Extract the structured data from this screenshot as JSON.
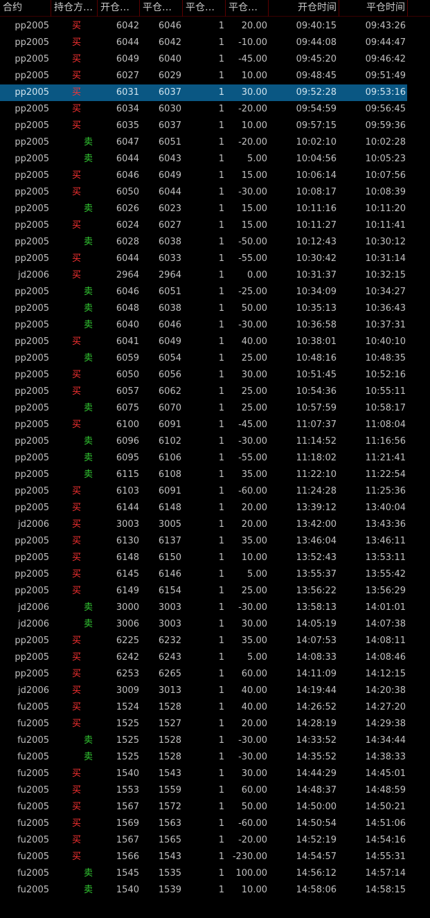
{
  "colors": {
    "background": "#000000",
    "text": "#c0c0c0",
    "buy": "#ff3333",
    "sell": "#33cc33",
    "selected_row": "#0a5783",
    "header_border": "#5a0000"
  },
  "headers": [
    "合约",
    "持仓方…",
    "开仓…",
    "平仓…",
    "平仓…",
    "平仓…",
    "开仓时间",
    "平仓时间"
  ],
  "selected_index": 4,
  "rows": [
    {
      "contract": "pp2005",
      "dir": "买",
      "open": "6042",
      "close": "6046",
      "qty": "1",
      "pnl": "20.00",
      "open_time": "09:40:15",
      "close_time": "09:43:26"
    },
    {
      "contract": "pp2005",
      "dir": "买",
      "open": "6044",
      "close": "6042",
      "qty": "1",
      "pnl": "-10.00",
      "open_time": "09:44:08",
      "close_time": "09:44:47"
    },
    {
      "contract": "pp2005",
      "dir": "买",
      "open": "6049",
      "close": "6040",
      "qty": "1",
      "pnl": "-45.00",
      "open_time": "09:45:20",
      "close_time": "09:46:42"
    },
    {
      "contract": "pp2005",
      "dir": "买",
      "open": "6027",
      "close": "6029",
      "qty": "1",
      "pnl": "10.00",
      "open_time": "09:48:45",
      "close_time": "09:51:49"
    },
    {
      "contract": "pp2005",
      "dir": "买",
      "open": "6031",
      "close": "6037",
      "qty": "1",
      "pnl": "30.00",
      "open_time": "09:52:28",
      "close_time": "09:53:16"
    },
    {
      "contract": "pp2005",
      "dir": "买",
      "open": "6034",
      "close": "6030",
      "qty": "1",
      "pnl": "-20.00",
      "open_time": "09:54:59",
      "close_time": "09:56:45"
    },
    {
      "contract": "pp2005",
      "dir": "买",
      "open": "6035",
      "close": "6037",
      "qty": "1",
      "pnl": "10.00",
      "open_time": "09:57:15",
      "close_time": "09:59:36"
    },
    {
      "contract": "pp2005",
      "dir": "卖",
      "open": "6047",
      "close": "6051",
      "qty": "1",
      "pnl": "-20.00",
      "open_time": "10:02:10",
      "close_time": "10:02:28"
    },
    {
      "contract": "pp2005",
      "dir": "卖",
      "open": "6044",
      "close": "6043",
      "qty": "1",
      "pnl": "5.00",
      "open_time": "10:04:56",
      "close_time": "10:05:23"
    },
    {
      "contract": "pp2005",
      "dir": "买",
      "open": "6046",
      "close": "6049",
      "qty": "1",
      "pnl": "15.00",
      "open_time": "10:06:14",
      "close_time": "10:07:56"
    },
    {
      "contract": "pp2005",
      "dir": "买",
      "open": "6050",
      "close": "6044",
      "qty": "1",
      "pnl": "-30.00",
      "open_time": "10:08:17",
      "close_time": "10:08:39"
    },
    {
      "contract": "pp2005",
      "dir": "卖",
      "open": "6026",
      "close": "6023",
      "qty": "1",
      "pnl": "15.00",
      "open_time": "10:11:16",
      "close_time": "10:11:20"
    },
    {
      "contract": "pp2005",
      "dir": "买",
      "open": "6024",
      "close": "6027",
      "qty": "1",
      "pnl": "15.00",
      "open_time": "10:11:27",
      "close_time": "10:11:41"
    },
    {
      "contract": "pp2005",
      "dir": "卖",
      "open": "6028",
      "close": "6038",
      "qty": "1",
      "pnl": "-50.00",
      "open_time": "10:12:43",
      "close_time": "10:30:12"
    },
    {
      "contract": "pp2005",
      "dir": "买",
      "open": "6044",
      "close": "6033",
      "qty": "1",
      "pnl": "-55.00",
      "open_time": "10:30:42",
      "close_time": "10:31:14"
    },
    {
      "contract": "jd2006",
      "dir": "买",
      "open": "2964",
      "close": "2964",
      "qty": "1",
      "pnl": "0.00",
      "open_time": "10:31:37",
      "close_time": "10:32:15"
    },
    {
      "contract": "pp2005",
      "dir": "卖",
      "open": "6046",
      "close": "6051",
      "qty": "1",
      "pnl": "-25.00",
      "open_time": "10:34:09",
      "close_time": "10:34:27"
    },
    {
      "contract": "pp2005",
      "dir": "卖",
      "open": "6048",
      "close": "6038",
      "qty": "1",
      "pnl": "50.00",
      "open_time": "10:35:13",
      "close_time": "10:36:43"
    },
    {
      "contract": "pp2005",
      "dir": "卖",
      "open": "6040",
      "close": "6046",
      "qty": "1",
      "pnl": "-30.00",
      "open_time": "10:36:58",
      "close_time": "10:37:31"
    },
    {
      "contract": "pp2005",
      "dir": "买",
      "open": "6041",
      "close": "6049",
      "qty": "1",
      "pnl": "40.00",
      "open_time": "10:38:01",
      "close_time": "10:40:10"
    },
    {
      "contract": "pp2005",
      "dir": "卖",
      "open": "6059",
      "close": "6054",
      "qty": "1",
      "pnl": "25.00",
      "open_time": "10:48:16",
      "close_time": "10:48:35"
    },
    {
      "contract": "pp2005",
      "dir": "买",
      "open": "6050",
      "close": "6056",
      "qty": "1",
      "pnl": "30.00",
      "open_time": "10:51:45",
      "close_time": "10:52:16"
    },
    {
      "contract": "pp2005",
      "dir": "买",
      "open": "6057",
      "close": "6062",
      "qty": "1",
      "pnl": "25.00",
      "open_time": "10:54:36",
      "close_time": "10:55:11"
    },
    {
      "contract": "pp2005",
      "dir": "卖",
      "open": "6075",
      "close": "6070",
      "qty": "1",
      "pnl": "25.00",
      "open_time": "10:57:59",
      "close_time": "10:58:17"
    },
    {
      "contract": "pp2005",
      "dir": "买",
      "open": "6100",
      "close": "6091",
      "qty": "1",
      "pnl": "-45.00",
      "open_time": "11:07:37",
      "close_time": "11:08:04"
    },
    {
      "contract": "pp2005",
      "dir": "卖",
      "open": "6096",
      "close": "6102",
      "qty": "1",
      "pnl": "-30.00",
      "open_time": "11:14:52",
      "close_time": "11:16:56"
    },
    {
      "contract": "pp2005",
      "dir": "卖",
      "open": "6095",
      "close": "6106",
      "qty": "1",
      "pnl": "-55.00",
      "open_time": "11:18:02",
      "close_time": "11:21:41"
    },
    {
      "contract": "pp2005",
      "dir": "卖",
      "open": "6115",
      "close": "6108",
      "qty": "1",
      "pnl": "35.00",
      "open_time": "11:22:10",
      "close_time": "11:22:54"
    },
    {
      "contract": "pp2005",
      "dir": "买",
      "open": "6103",
      "close": "6091",
      "qty": "1",
      "pnl": "-60.00",
      "open_time": "11:24:28",
      "close_time": "11:25:36"
    },
    {
      "contract": "pp2005",
      "dir": "买",
      "open": "6144",
      "close": "6148",
      "qty": "1",
      "pnl": "20.00",
      "open_time": "13:39:12",
      "close_time": "13:40:04"
    },
    {
      "contract": "jd2006",
      "dir": "买",
      "open": "3003",
      "close": "3005",
      "qty": "1",
      "pnl": "20.00",
      "open_time": "13:42:00",
      "close_time": "13:43:36"
    },
    {
      "contract": "pp2005",
      "dir": "买",
      "open": "6130",
      "close": "6137",
      "qty": "1",
      "pnl": "35.00",
      "open_time": "13:46:04",
      "close_time": "13:46:11"
    },
    {
      "contract": "pp2005",
      "dir": "买",
      "open": "6148",
      "close": "6150",
      "qty": "1",
      "pnl": "10.00",
      "open_time": "13:52:43",
      "close_time": "13:53:11"
    },
    {
      "contract": "pp2005",
      "dir": "买",
      "open": "6145",
      "close": "6146",
      "qty": "1",
      "pnl": "5.00",
      "open_time": "13:55:37",
      "close_time": "13:55:42"
    },
    {
      "contract": "pp2005",
      "dir": "买",
      "open": "6149",
      "close": "6154",
      "qty": "1",
      "pnl": "25.00",
      "open_time": "13:56:22",
      "close_time": "13:56:29"
    },
    {
      "contract": "jd2006",
      "dir": "卖",
      "open": "3000",
      "close": "3003",
      "qty": "1",
      "pnl": "-30.00",
      "open_time": "13:58:13",
      "close_time": "14:01:01"
    },
    {
      "contract": "jd2006",
      "dir": "卖",
      "open": "3006",
      "close": "3003",
      "qty": "1",
      "pnl": "30.00",
      "open_time": "14:05:19",
      "close_time": "14:07:38"
    },
    {
      "contract": "pp2005",
      "dir": "买",
      "open": "6225",
      "close": "6232",
      "qty": "1",
      "pnl": "35.00",
      "open_time": "14:07:53",
      "close_time": "14:08:11"
    },
    {
      "contract": "pp2005",
      "dir": "买",
      "open": "6242",
      "close": "6243",
      "qty": "1",
      "pnl": "5.00",
      "open_time": "14:08:33",
      "close_time": "14:08:46"
    },
    {
      "contract": "pp2005",
      "dir": "买",
      "open": "6253",
      "close": "6265",
      "qty": "1",
      "pnl": "60.00",
      "open_time": "14:11:09",
      "close_time": "14:12:15"
    },
    {
      "contract": "jd2006",
      "dir": "买",
      "open": "3009",
      "close": "3013",
      "qty": "1",
      "pnl": "40.00",
      "open_time": "14:19:44",
      "close_time": "14:20:38"
    },
    {
      "contract": "fu2005",
      "dir": "买",
      "open": "1524",
      "close": "1528",
      "qty": "1",
      "pnl": "40.00",
      "open_time": "14:26:52",
      "close_time": "14:27:20"
    },
    {
      "contract": "fu2005",
      "dir": "买",
      "open": "1525",
      "close": "1527",
      "qty": "1",
      "pnl": "20.00",
      "open_time": "14:28:19",
      "close_time": "14:29:38"
    },
    {
      "contract": "fu2005",
      "dir": "卖",
      "open": "1525",
      "close": "1528",
      "qty": "1",
      "pnl": "-30.00",
      "open_time": "14:33:52",
      "close_time": "14:34:44"
    },
    {
      "contract": "fu2005",
      "dir": "卖",
      "open": "1525",
      "close": "1528",
      "qty": "1",
      "pnl": "-30.00",
      "open_time": "14:35:52",
      "close_time": "14:38:33"
    },
    {
      "contract": "fu2005",
      "dir": "买",
      "open": "1540",
      "close": "1543",
      "qty": "1",
      "pnl": "30.00",
      "open_time": "14:44:29",
      "close_time": "14:45:01"
    },
    {
      "contract": "fu2005",
      "dir": "买",
      "open": "1553",
      "close": "1559",
      "qty": "1",
      "pnl": "60.00",
      "open_time": "14:48:37",
      "close_time": "14:48:59"
    },
    {
      "contract": "fu2005",
      "dir": "买",
      "open": "1567",
      "close": "1572",
      "qty": "1",
      "pnl": "50.00",
      "open_time": "14:50:00",
      "close_time": "14:50:21"
    },
    {
      "contract": "fu2005",
      "dir": "买",
      "open": "1569",
      "close": "1563",
      "qty": "1",
      "pnl": "-60.00",
      "open_time": "14:50:54",
      "close_time": "14:51:06"
    },
    {
      "contract": "fu2005",
      "dir": "买",
      "open": "1567",
      "close": "1565",
      "qty": "1",
      "pnl": "-20.00",
      "open_time": "14:52:19",
      "close_time": "14:54:16"
    },
    {
      "contract": "fu2005",
      "dir": "买",
      "open": "1566",
      "close": "1543",
      "qty": "1",
      "pnl": "-230.00",
      "open_time": "14:54:57",
      "close_time": "14:55:31"
    },
    {
      "contract": "fu2005",
      "dir": "卖",
      "open": "1545",
      "close": "1535",
      "qty": "1",
      "pnl": "100.00",
      "open_time": "14:56:12",
      "close_time": "14:57:14"
    },
    {
      "contract": "fu2005",
      "dir": "卖",
      "open": "1540",
      "close": "1539",
      "qty": "1",
      "pnl": "10.00",
      "open_time": "14:58:06",
      "close_time": "14:58:15"
    }
  ]
}
